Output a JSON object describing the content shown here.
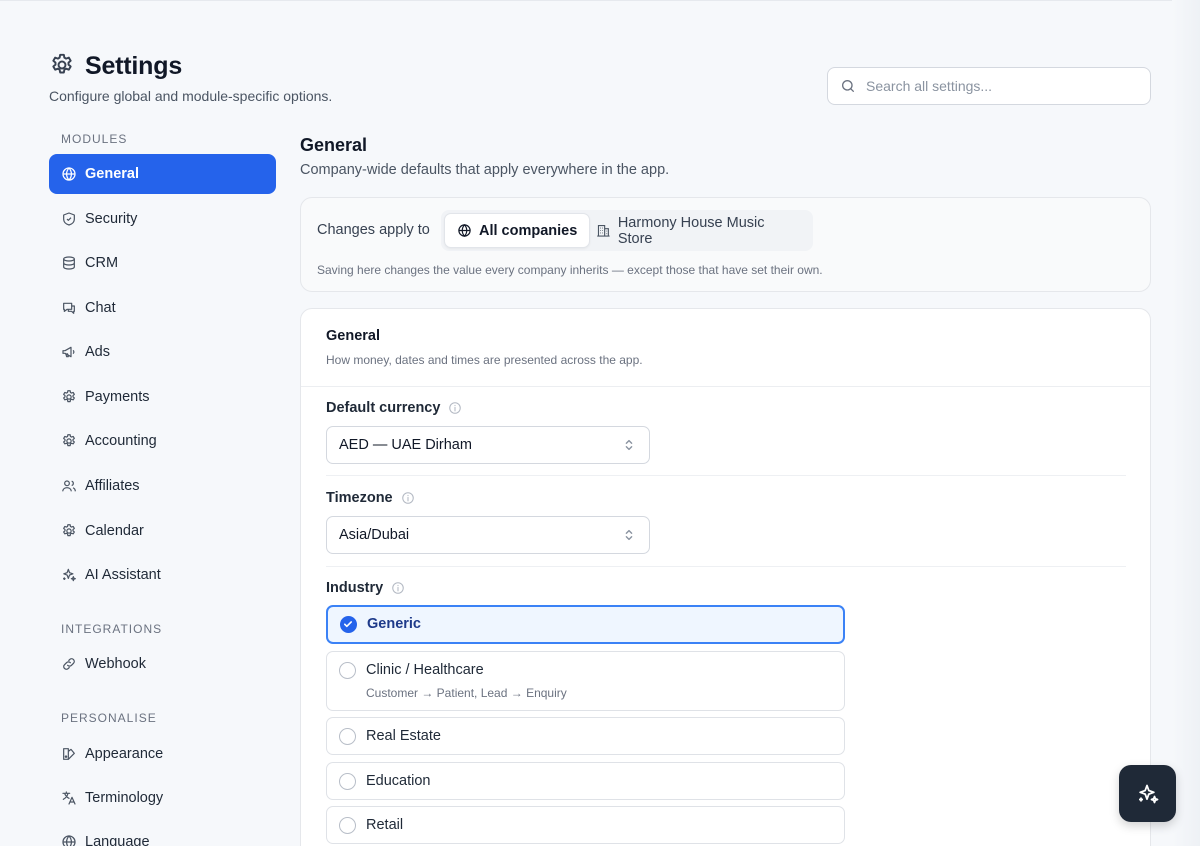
{
  "header": {
    "title": "Settings",
    "subtitle": "Configure global and module-specific options.",
    "icon": "gear-icon"
  },
  "search": {
    "placeholder": "Search all settings...",
    "value": ""
  },
  "sidebar": {
    "sections": [
      {
        "title": "MODULES",
        "items": [
          {
            "label": "General",
            "icon": "globe-icon",
            "active": true
          },
          {
            "label": "Security",
            "icon": "shield-icon"
          },
          {
            "label": "CRM",
            "icon": "database-icon"
          },
          {
            "label": "Chat",
            "icon": "chat-icon"
          },
          {
            "label": "Ads",
            "icon": "megaphone-icon"
          },
          {
            "label": "Payments",
            "icon": "gear-icon"
          },
          {
            "label": "Accounting",
            "icon": "gear-icon"
          },
          {
            "label": "Affiliates",
            "icon": "users-icon"
          },
          {
            "label": "Calendar",
            "icon": "gear-icon"
          },
          {
            "label": "AI Assistant",
            "icon": "sparkles-icon"
          }
        ]
      },
      {
        "title": "INTEGRATIONS",
        "items": [
          {
            "label": "Webhook",
            "icon": "link-icon"
          }
        ]
      },
      {
        "title": "PERSONALISE",
        "items": [
          {
            "label": "Appearance",
            "icon": "palette-icon"
          },
          {
            "label": "Terminology",
            "icon": "translate-icon"
          },
          {
            "label": "Language",
            "icon": "globe-icon"
          }
        ]
      }
    ]
  },
  "main": {
    "title": "General",
    "subtitle": "Company-wide defaults that apply everywhere in the app.",
    "scope": {
      "label": "Changes apply to",
      "options": [
        {
          "label": "All companies",
          "icon": "globe-icon",
          "selected": true
        },
        {
          "label": "Harmony House Music Store",
          "icon": "building-icon",
          "selected": false
        }
      ],
      "note": "Saving here changes the value every company inherits — except those that have set their own."
    },
    "card": {
      "title": "General",
      "subtitle": "How money, dates and times are presented across the app.",
      "currency": {
        "label": "Default currency",
        "value": "AED — UAE Dirham"
      },
      "timezone": {
        "label": "Timezone",
        "value": "Asia/Dubai"
      },
      "industry": {
        "label": "Industry",
        "options": [
          {
            "label": "Generic",
            "selected": true,
            "desc": ""
          },
          {
            "label": "Clinic / Healthcare",
            "selected": false,
            "desc": "Customer → Patient, Lead → Enquiry"
          },
          {
            "label": "Real Estate",
            "selected": false,
            "desc": ""
          },
          {
            "label": "Education",
            "selected": false,
            "desc": ""
          },
          {
            "label": "Retail",
            "selected": false,
            "desc": ""
          }
        ]
      }
    }
  },
  "fab": {
    "icon": "sparkles-icon"
  },
  "colors": {
    "accent": "#2563eb",
    "selected_bg": "#eff6ff",
    "fab_bg": "#1f2937"
  }
}
